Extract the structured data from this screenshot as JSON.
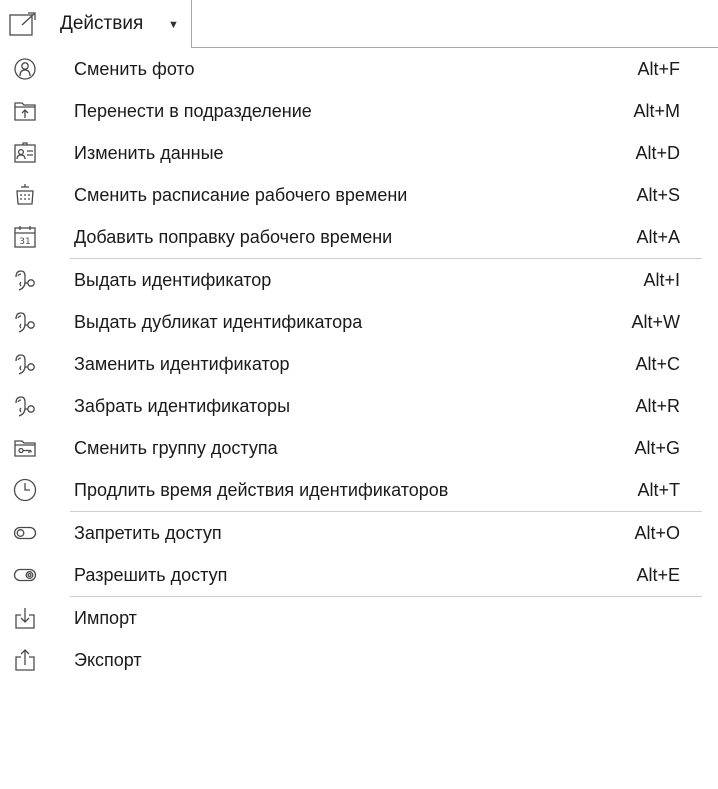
{
  "menu_button": {
    "label": "Действия",
    "icon": "external-window-icon",
    "caret": "chevron-down-icon"
  },
  "groups": [
    [
      {
        "name": "change-photo",
        "icon": "face-icon",
        "label": "Сменить фото",
        "shortcut": "Alt+F"
      },
      {
        "name": "move-to-department",
        "icon": "move-folder-icon",
        "label": "Перенести в подразделение",
        "shortcut": "Alt+M"
      },
      {
        "name": "edit-data",
        "icon": "id-card-icon",
        "label": "Изменить данные",
        "shortcut": "Alt+D"
      },
      {
        "name": "change-work-schedule",
        "icon": "schedule-icon",
        "label": "Сменить расписание рабочего времени",
        "shortcut": "Alt+S"
      },
      {
        "name": "add-work-time-correction",
        "icon": "calendar-31-icon",
        "label": "Добавить поправку рабочего времени",
        "shortcut": "Alt+A"
      }
    ],
    [
      {
        "name": "issue-identifier",
        "icon": "hand-key-icon",
        "label": "Выдать идентификатор",
        "shortcut": "Alt+I"
      },
      {
        "name": "issue-duplicate-identifier",
        "icon": "hand-key-icon",
        "label": "Выдать дубликат идентификатора",
        "shortcut": "Alt+W"
      },
      {
        "name": "replace-identifier",
        "icon": "hand-key-icon",
        "label": "Заменить идентификатор",
        "shortcut": "Alt+C"
      },
      {
        "name": "revoke-identifiers",
        "icon": "hand-key-icon",
        "label": "Забрать идентификаторы",
        "shortcut": "Alt+R"
      },
      {
        "name": "change-access-group",
        "icon": "access-card-icon",
        "label": "Сменить группу доступа",
        "shortcut": "Alt+G"
      },
      {
        "name": "extend-identifier-validity",
        "icon": "clock-icon",
        "label": "Продлить время действия идентификаторов",
        "shortcut": "Alt+T"
      }
    ],
    [
      {
        "name": "deny-access",
        "icon": "toggle-off-icon",
        "label": "Запретить доступ",
        "shortcut": "Alt+O"
      },
      {
        "name": "allow-access",
        "icon": "toggle-on-icon",
        "label": "Разрешить доступ",
        "shortcut": "Alt+E"
      }
    ],
    [
      {
        "name": "import",
        "icon": "import-icon",
        "label": "Импорт",
        "shortcut": ""
      },
      {
        "name": "export",
        "icon": "export-icon",
        "label": "Экспорт",
        "shortcut": ""
      }
    ]
  ]
}
